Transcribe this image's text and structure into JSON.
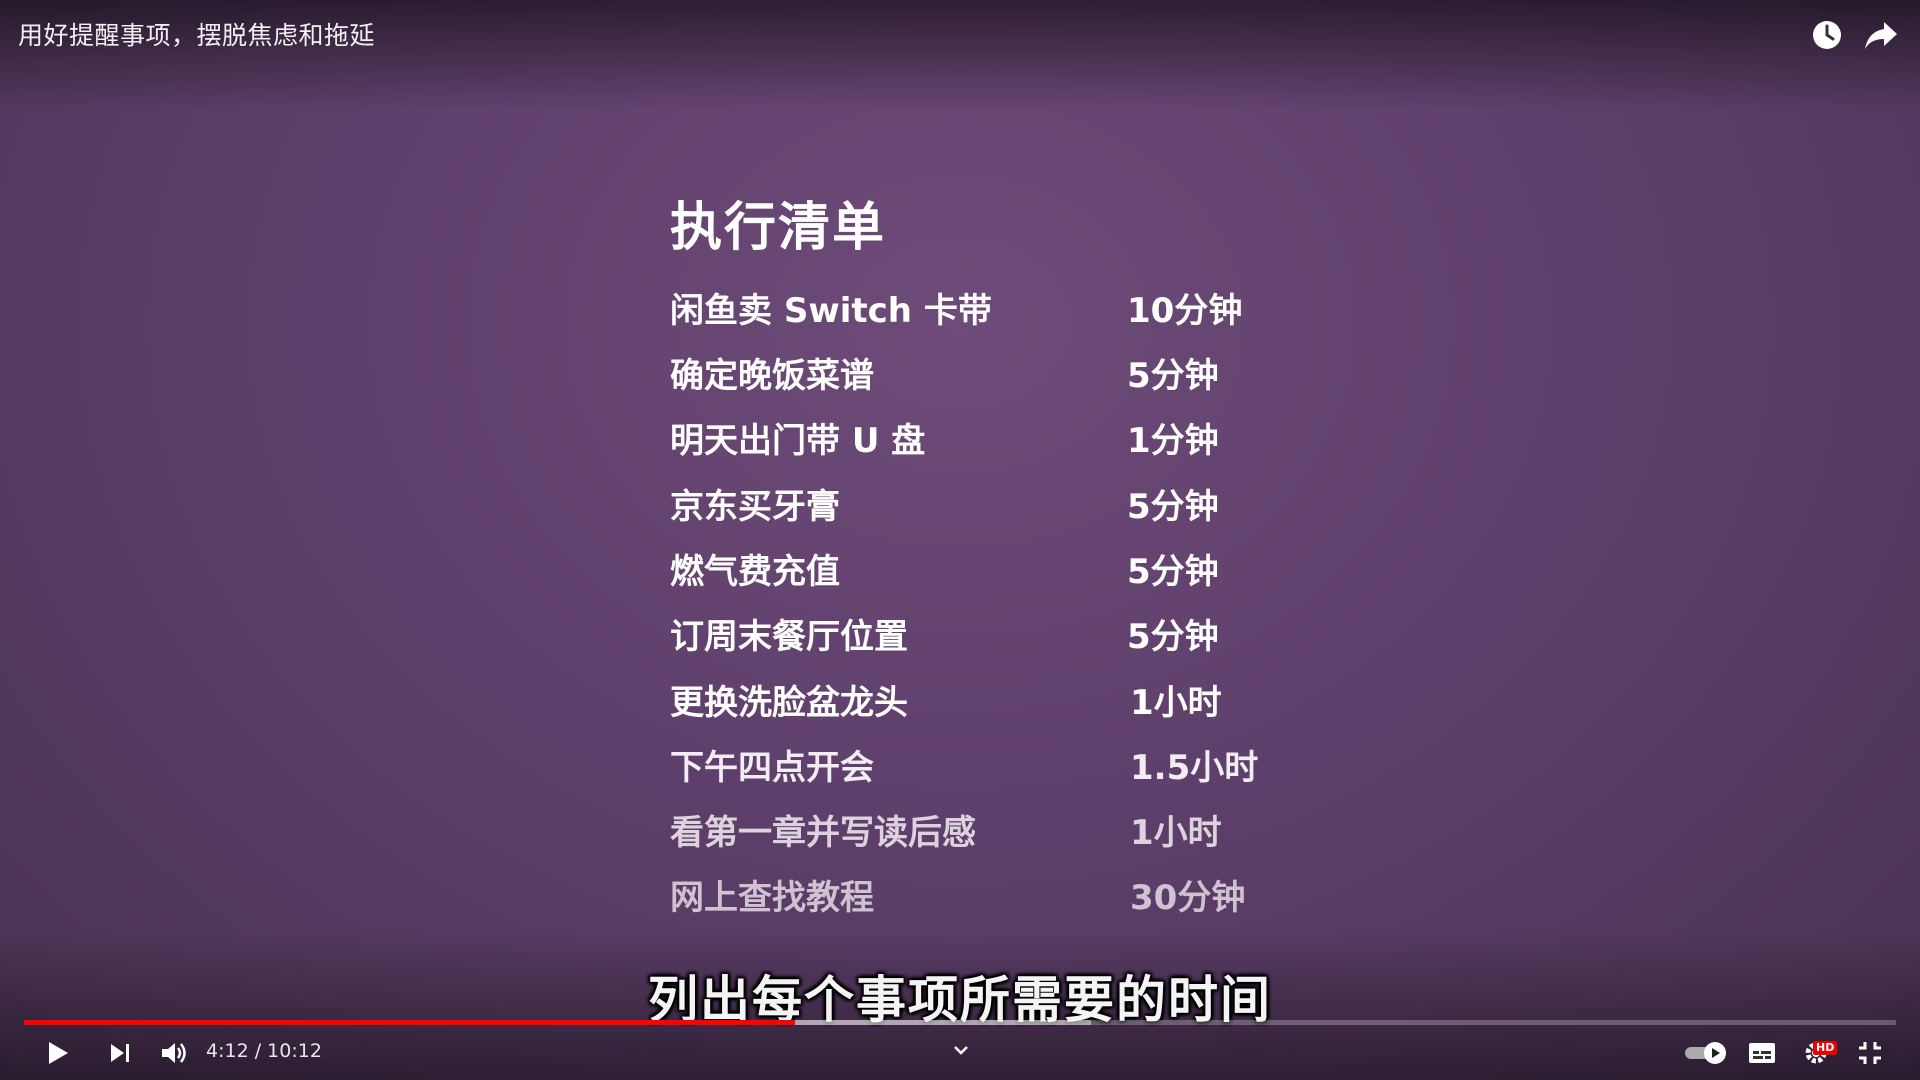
{
  "header": {
    "video_title": "用好提醒事项，摆脱焦虑和拖延",
    "icons": [
      "watch-later-icon",
      "share-icon"
    ]
  },
  "slide": {
    "heading": "执行清单",
    "tasks": [
      {
        "name": "闲鱼卖 Switch 卡带",
        "time": "10分钟"
      },
      {
        "name": "确定晚饭菜谱",
        "time": "5分钟"
      },
      {
        "name": "明天出门带 U 盘",
        "time": "1分钟"
      },
      {
        "name": "京东买牙膏",
        "time": "5分钟"
      },
      {
        "name": "燃气费充值",
        "time": "5分钟"
      },
      {
        "name": "订周末餐厅位置",
        "time": "5分钟"
      },
      {
        "name": "更换洗脸盆龙头",
        "time": "1小时"
      },
      {
        "name": "下午四点开会",
        "time": "1.5小时"
      },
      {
        "name": "看第一章并写读后感",
        "time": "1小时"
      },
      {
        "name": "网上查找教程",
        "time": "30分钟"
      }
    ]
  },
  "subtitle": "列出每个事项所需要的时间",
  "player": {
    "time_display": "4:12 / 10:12",
    "played_fraction": 0.412,
    "buffered_fraction": 0.57,
    "hd_badge": "HD",
    "accent_color": "#ff0000"
  }
}
